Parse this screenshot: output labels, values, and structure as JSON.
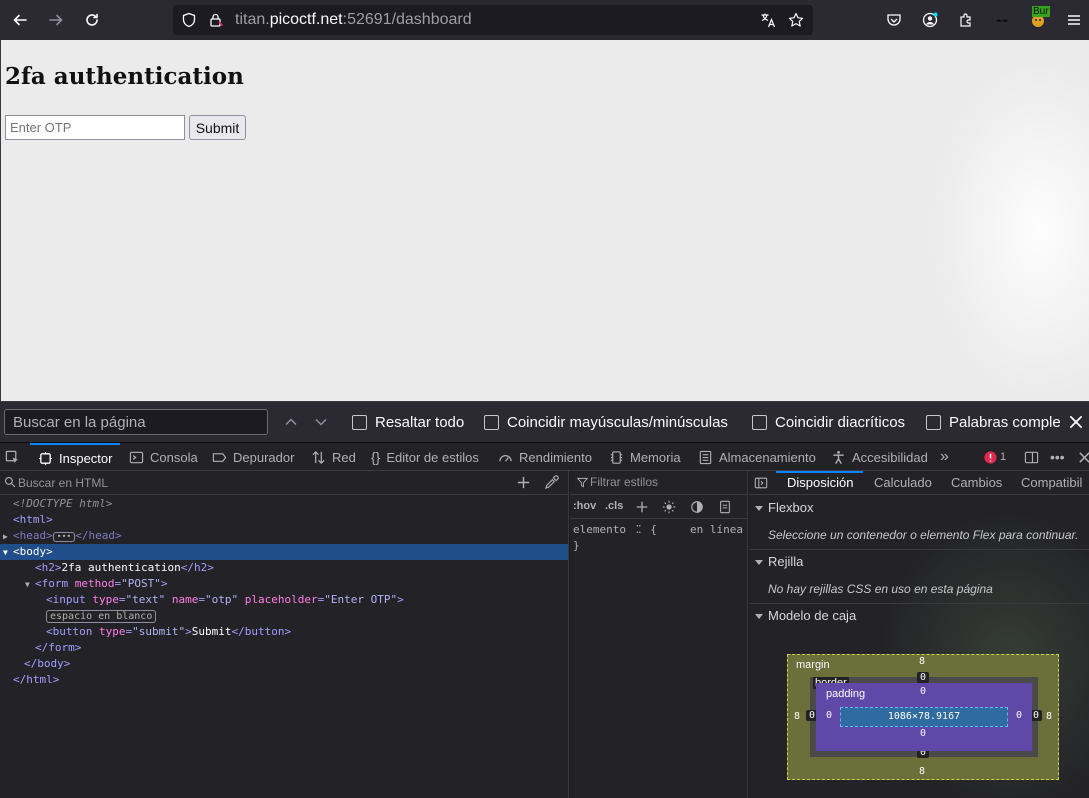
{
  "browser": {
    "url_prefix": "titan.",
    "url_host": "picoctf.net",
    "url_suffix": ":52691/dashboard",
    "profile_badge": "Bur"
  },
  "page": {
    "heading": "2fa authentication",
    "otp_placeholder": "Enter OTP",
    "submit_label": "Submit"
  },
  "findbar": {
    "placeholder": "Buscar en la página",
    "highlight_all": "Resaltar todo",
    "match_case": "Coincidir mayúsculas/minúsculas",
    "match_diacritics": "Coincidir diacríticos",
    "whole_words": "Palabras comple"
  },
  "devtools": {
    "tabs": [
      "Inspector",
      "Consola",
      "Depurador",
      "Red",
      "Editor de estilos",
      "Rendimiento",
      "Memoria",
      "Almacenamiento",
      "Accesibilidad"
    ],
    "error_count": "1",
    "search_html_placeholder": "Buscar en HTML",
    "markup": {
      "doctype": "<!DOCTYPE html>",
      "whitespace_chip": "espacio en blanco",
      "h2_text": "2fa authentication",
      "button_text": "Submit"
    },
    "rules": {
      "filter_placeholder": "Filtrar estilos",
      "hov": ":hov",
      "cls": ".cls",
      "element_selector": "elemento",
      "open_brace": "{",
      "close_brace": "}",
      "inline": "en línea"
    },
    "layout": {
      "subtabs": [
        "Disposición",
        "Calculado",
        "Cambios",
        "Compatibil"
      ],
      "flexbox_title": "Flexbox",
      "flexbox_note": "Seleccione un contenedor o elemento Flex para continuar.",
      "grid_title": "Rejilla",
      "grid_note": "No hay rejillas CSS en uso en esta página",
      "boxmodel_title": "Modelo de caja",
      "box": {
        "margin_label": "margin",
        "border_label": "border",
        "padding_label": "padding",
        "content_size": "1086×78.9167",
        "margin_top": "8",
        "margin_bottom": "8",
        "margin_left": "8",
        "margin_right": "8",
        "border_top": "0",
        "border_bottom": "0",
        "border_left": "0",
        "border_right": "0",
        "padding_top": "0",
        "padding_bottom": "0",
        "padding_left": "0",
        "padding_right": "0"
      }
    }
  }
}
